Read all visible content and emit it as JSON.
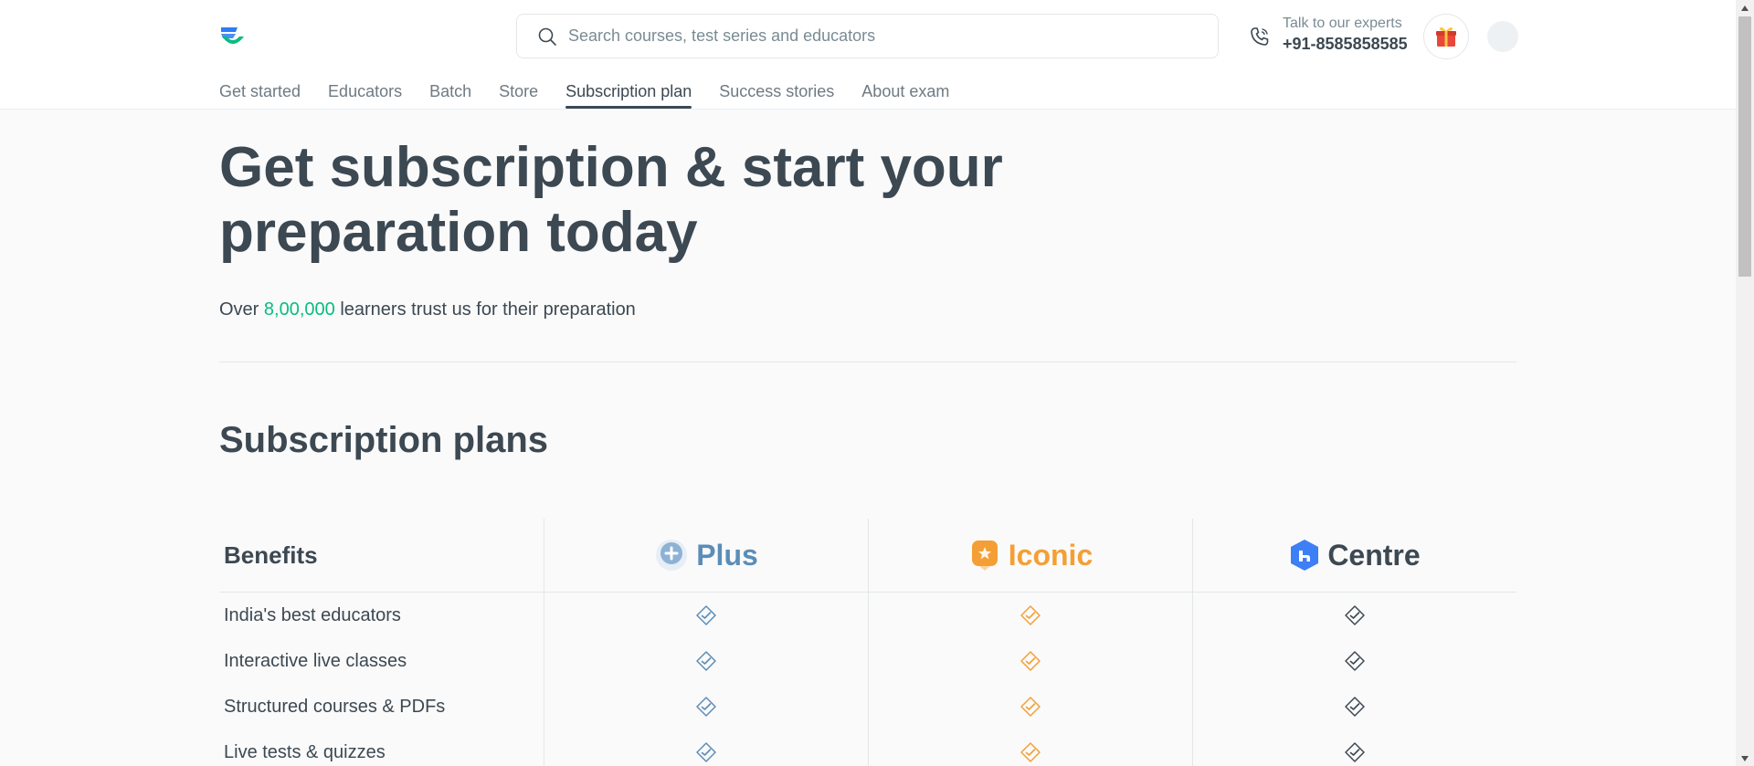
{
  "header": {
    "search_placeholder": "Search courses, test series and educators",
    "expert_label": "Talk to our experts",
    "expert_phone": "+91-8585858585"
  },
  "nav": {
    "items": [
      {
        "label": "Get started"
      },
      {
        "label": "Educators"
      },
      {
        "label": "Batch"
      },
      {
        "label": "Store"
      },
      {
        "label": "Subscription plan",
        "active": true
      },
      {
        "label": "Success stories"
      },
      {
        "label": "About exam"
      }
    ]
  },
  "hero": {
    "title": "Get subscription & start your preparation today",
    "sub_prefix": "Over ",
    "sub_highlight": "8,00,000",
    "sub_suffix": " learners trust us for their preparation"
  },
  "plans": {
    "title": "Subscription plans",
    "benefits_header": "Benefits",
    "plan_names": [
      "Plus",
      "Iconic",
      "Centre"
    ],
    "benefits": [
      "India's best educators",
      "Interactive live classes",
      "Structured courses & PDFs",
      "Live tests & quizzes"
    ]
  },
  "colors": {
    "accent_green": "#08bd80",
    "plus": "#5b8db8",
    "iconic": "#f49f35",
    "centre_badge": "#3d7ff5",
    "text": "#3c4852"
  },
  "icons": {
    "logo": "unacademy-logo",
    "search": "search-icon",
    "phone": "phone-icon",
    "gift": "gift-icon",
    "check": "check-badge-icon"
  }
}
